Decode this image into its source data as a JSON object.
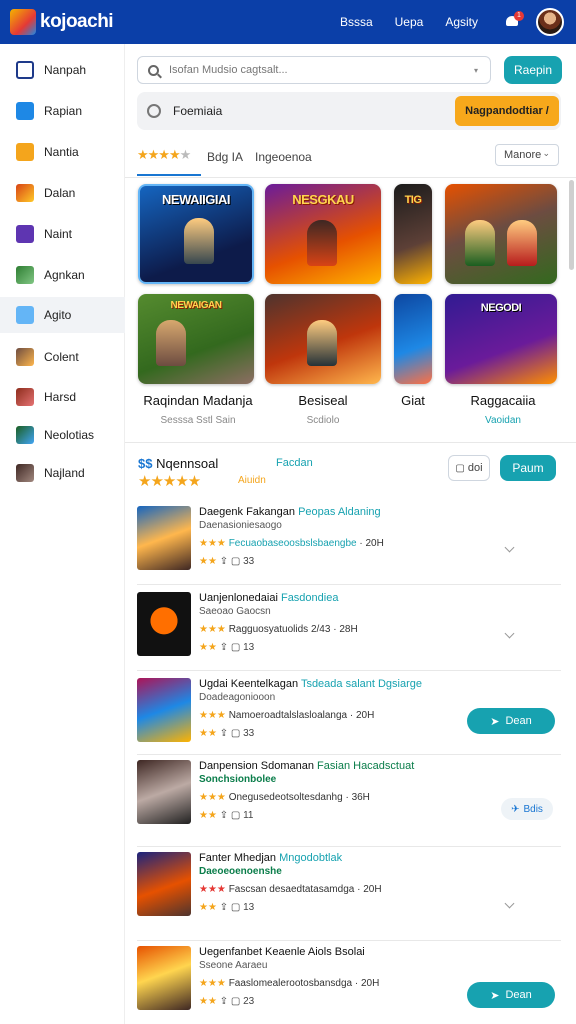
{
  "header": {
    "app_title": "kojoachi",
    "nav": [
      "Bsssa",
      "Uepa",
      "Agsity"
    ],
    "notification_count": "1"
  },
  "sidebar": {
    "items": [
      {
        "label": "Nanpah",
        "icon": "grid-icon",
        "color": "#1e3a8a"
      },
      {
        "label": "Rapian",
        "icon": "app-icon",
        "color": "#1e88e5"
      },
      {
        "label": "Nantia",
        "icon": "game-icon",
        "color": "#f4a51c"
      },
      {
        "label": "Dalan",
        "icon": "thumb-icon",
        "color": "#d84315"
      },
      {
        "label": "Naint",
        "icon": "puzzle-icon",
        "color": "#5e35b1"
      },
      {
        "label": "Agnkan",
        "icon": "map-icon",
        "color": "#2e7d32"
      },
      {
        "label": "Agito",
        "icon": "tile-icon",
        "color": "#64b5f6"
      },
      {
        "label": "Colent",
        "icon": "photo-icon",
        "color": "#6d4c41"
      },
      {
        "label": "Harsd",
        "icon": "photo-icon",
        "color": "#8d2c1c"
      },
      {
        "label": "Neolotias",
        "icon": "photo-icon",
        "color": "#1b5e20"
      },
      {
        "label": "Najland",
        "icon": "photo-icon",
        "color": "#3e2723"
      }
    ],
    "active_index": 6
  },
  "search": {
    "placeholder": "Isofan Mudsio cagtsalt...",
    "button": "Raepin"
  },
  "filter": {
    "label": "Foemiaia",
    "button": "Nagpandodtiar /"
  },
  "tabs": {
    "rating_label": "Bdg IA",
    "second": "Ingeoenoa",
    "sort": "Manore"
  },
  "games": [
    {
      "banner": "NEWAIIGIAI",
      "title": "Raqindan Madanja",
      "sub": "Sesssa  Sstl Sain"
    },
    {
      "banner": "NESGKAU",
      "title": "Besiseal",
      "sub": "Scdiolo"
    },
    {
      "banner": "TIG",
      "title": "Giat",
      "sub": ""
    },
    {
      "banner": "",
      "title": "Raggacaiia",
      "sub": "Vaoidan"
    },
    {
      "banner": "NEWAIGAN",
      "title": "",
      "sub": ""
    },
    {
      "banner": "",
      "title": "",
      "sub": ""
    },
    {
      "banner": "",
      "title": "",
      "sub": ""
    },
    {
      "banner": "NEGODI",
      "title": "",
      "sub": ""
    }
  ],
  "featured": {
    "title_prefix": "$$",
    "title": "Nqennsoal",
    "link": "Facdan",
    "subtitle": "Aiuidn",
    "outline_button": "doi",
    "primary_button": "Paum"
  },
  "list": [
    {
      "title": "Daegenk Fakangan",
      "tag": "Peopas Aldaning",
      "line2": "Daenasioniesaogo",
      "rating_text": "Fecuaobaseoosbslsbaengbe",
      "meta": "20H",
      "count": "33",
      "action": ""
    },
    {
      "title": "Uanjenlonedaiai",
      "tag": "Fasdondiea",
      "line2": "Saeoao Gaocsn",
      "rating_text": "Ragguosyatuolids 2/43",
      "meta": "28H",
      "count": "13",
      "action": ""
    },
    {
      "title": "Ugdai Keentelkagan",
      "tag": "Tsdeada salant Dgsiarge",
      "line2": "Doadeagoniooon",
      "rating_text": "Namoeroadtalslasloalanga",
      "meta": "20H",
      "count": "33",
      "action": "Dean"
    },
    {
      "title": "Danpension Sdomanan",
      "tag": "Fasian Hacadsctuat",
      "line2": "Sonchsionbolee",
      "rating_text": "Onegusedeotsoltesdanhg",
      "meta": "36H",
      "count": "11",
      "action": "Bdis"
    },
    {
      "title": "Fanter Mhedjan",
      "tag": "Mngodobtlak",
      "line2": "Daeoeoenoenshe",
      "rating_text": "Fascsan desaedtatasamdga",
      "meta": "20H",
      "count": "13",
      "action": ""
    },
    {
      "title": "Uegenfanbet Keaenle",
      "tag": "Aiols Bsolai",
      "line2": "Sseone Aaraeu",
      "rating_text": "Faaslomealerootosbansdga",
      "meta": "20H",
      "count": "23",
      "action": "Dean"
    }
  ]
}
